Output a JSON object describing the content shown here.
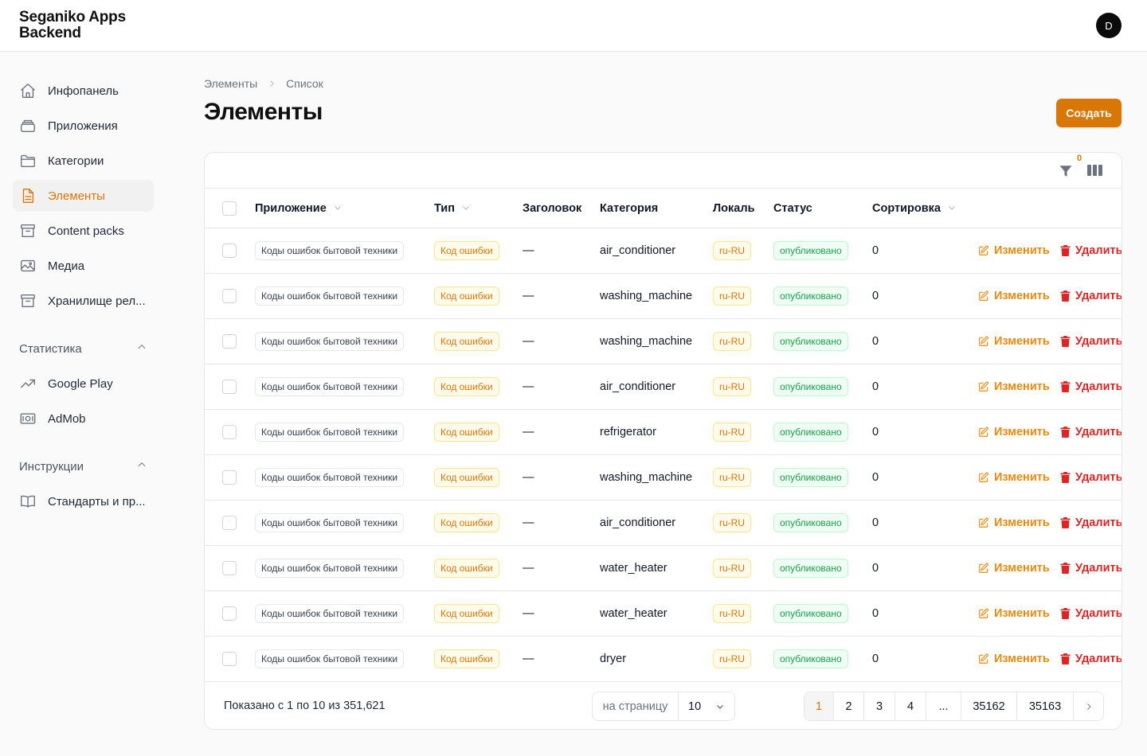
{
  "app": {
    "title_line1": "Seganiko Apps",
    "title_line2": "Backend",
    "avatar_letter": "D"
  },
  "sidebar": {
    "items": [
      {
        "label": "Инфопанель",
        "icon": "home-icon",
        "active": false
      },
      {
        "label": "Приложения",
        "icon": "layers-icon",
        "active": false
      },
      {
        "label": "Категории",
        "icon": "folder-icon",
        "active": false
      },
      {
        "label": "Элементы",
        "icon": "document-icon",
        "active": true
      },
      {
        "label": "Content packs",
        "icon": "archive-icon",
        "active": false
      },
      {
        "label": "Медиа",
        "icon": "image-icon",
        "active": false
      },
      {
        "label": "Хранилище рел...",
        "icon": "archive-icon",
        "active": false
      }
    ],
    "groups": [
      {
        "label": "Статистика",
        "items": [
          {
            "label": "Google Play",
            "icon": "trending-up-icon"
          },
          {
            "label": "AdMob",
            "icon": "cash-icon"
          }
        ]
      },
      {
        "label": "Инструкции",
        "items": [
          {
            "label": "Стандарты и пр...",
            "icon": "book-icon"
          }
        ]
      }
    ]
  },
  "breadcrumb": {
    "first": "Элементы",
    "second": "Список"
  },
  "page": {
    "title": "Элементы",
    "create_label": "Создать"
  },
  "toolbar": {
    "filter_count": "0"
  },
  "table": {
    "columns": {
      "app": "Приложение",
      "type": "Тип",
      "title": "Заголовок",
      "category": "Категория",
      "locale": "Локаль",
      "status": "Статус",
      "sort": "Сортировка"
    },
    "edit_label": "Изменить",
    "delete_label": "Удалить",
    "rows": [
      {
        "app": "Коды ошибок бытовой техники",
        "type": "Код ошибки",
        "title": "—",
        "category": "air_conditioner",
        "locale": "ru-RU",
        "status": "опубликовано",
        "sort": "0"
      },
      {
        "app": "Коды ошибок бытовой техники",
        "type": "Код ошибки",
        "title": "—",
        "category": "washing_machine",
        "locale": "ru-RU",
        "status": "опубликовано",
        "sort": "0"
      },
      {
        "app": "Коды ошибок бытовой техники",
        "type": "Код ошибки",
        "title": "—",
        "category": "washing_machine",
        "locale": "ru-RU",
        "status": "опубликовано",
        "sort": "0"
      },
      {
        "app": "Коды ошибок бытовой техники",
        "type": "Код ошибки",
        "title": "—",
        "category": "air_conditioner",
        "locale": "ru-RU",
        "status": "опубликовано",
        "sort": "0"
      },
      {
        "app": "Коды ошибок бытовой техники",
        "type": "Код ошибки",
        "title": "—",
        "category": "refrigerator",
        "locale": "ru-RU",
        "status": "опубликовано",
        "sort": "0"
      },
      {
        "app": "Коды ошибок бытовой техники",
        "type": "Код ошибки",
        "title": "—",
        "category": "washing_machine",
        "locale": "ru-RU",
        "status": "опубликовано",
        "sort": "0"
      },
      {
        "app": "Коды ошибок бытовой техники",
        "type": "Код ошибки",
        "title": "—",
        "category": "air_conditioner",
        "locale": "ru-RU",
        "status": "опубликовано",
        "sort": "0"
      },
      {
        "app": "Коды ошибок бытовой техники",
        "type": "Код ошибки",
        "title": "—",
        "category": "water_heater",
        "locale": "ru-RU",
        "status": "опубликовано",
        "sort": "0"
      },
      {
        "app": "Коды ошибок бытовой техники",
        "type": "Код ошибки",
        "title": "—",
        "category": "water_heater",
        "locale": "ru-RU",
        "status": "опубликовано",
        "sort": "0"
      },
      {
        "app": "Коды ошибок бытовой техники",
        "type": "Код ошибки",
        "title": "—",
        "category": "dryer",
        "locale": "ru-RU",
        "status": "опубликовано",
        "sort": "0"
      }
    ]
  },
  "footer": {
    "summary": "Показано с 1 по 10 из 351,621",
    "per_page_label": "на страницу",
    "per_page_value": "10",
    "pages": [
      "1",
      "2",
      "3",
      "4",
      "...",
      "35162",
      "35163"
    ],
    "current_page": "1"
  },
  "colors": {
    "accent": "#d97706",
    "danger": "#dc2626",
    "success": "#16a34a"
  }
}
